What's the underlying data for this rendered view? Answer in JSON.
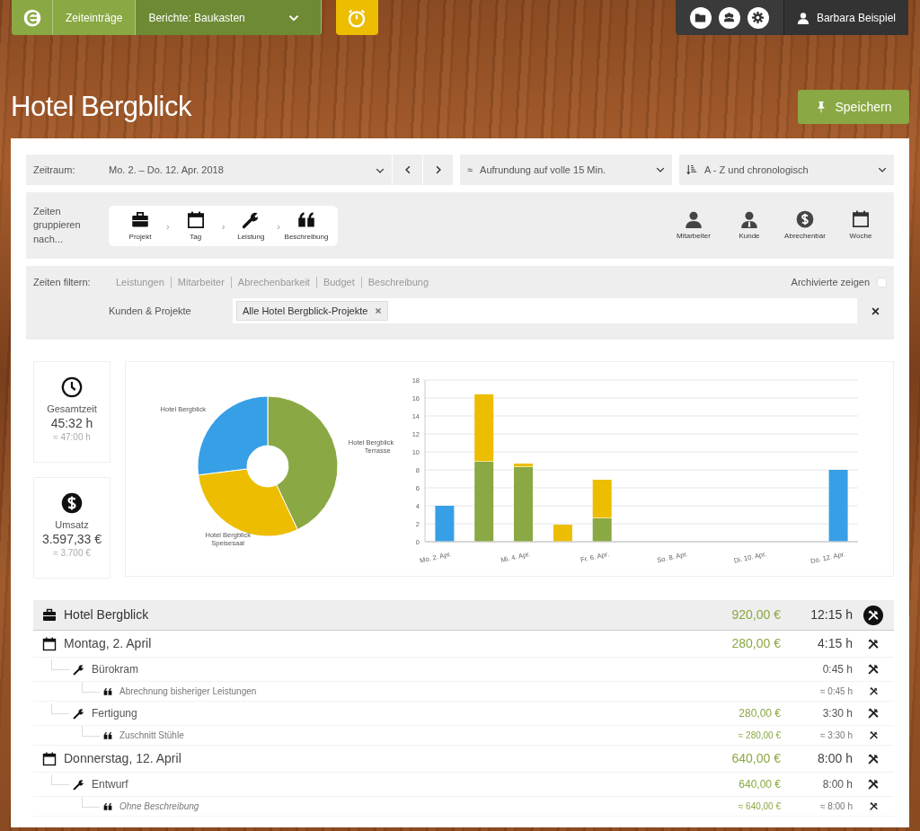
{
  "nav": {
    "tabs": [
      {
        "label": "Zeiteinträge",
        "selected": false
      },
      {
        "label": "Berichte: Baukasten",
        "selected": true
      }
    ],
    "user": "Barbara Beispiel"
  },
  "page_title": "Hotel Bergblick",
  "save_button": "Speichern",
  "period": {
    "label": "Zeitraum:",
    "value": "Mo. 2. – Do. 12. Apr. 2018"
  },
  "rounding": {
    "symbol": "≈",
    "value": "Aufrundung auf volle 15 Min."
  },
  "sorting": {
    "value": "A - Z und chronologisch"
  },
  "grouping": {
    "label": "Zeiten gruppieren nach...",
    "separator": "›",
    "active": [
      {
        "kind": "project",
        "label": "Projekt"
      },
      {
        "kind": "day",
        "label": "Tag"
      },
      {
        "kind": "service",
        "label": "Leistung"
      },
      {
        "kind": "description",
        "label": "Beschreibung"
      }
    ],
    "available": [
      {
        "kind": "person",
        "label": "Mitarbeiter"
      },
      {
        "kind": "customer",
        "label": "Kunde"
      },
      {
        "kind": "billable",
        "label": "Abrechenbar"
      },
      {
        "kind": "week",
        "label": "Woche"
      }
    ]
  },
  "filter": {
    "label": "Zeiten filtern:",
    "links": [
      "Leistungen",
      "Mitarbeiter",
      "Abrechenbarkeit",
      "Budget",
      "Beschreibung"
    ],
    "archived": {
      "label": "Archivierte zeigen",
      "checked": false
    },
    "customers_label": "Kunden & Projekte",
    "tags": [
      "Alle Hotel Bergblick-Projekte"
    ]
  },
  "stats": [
    {
      "kind": "time",
      "title": "Gesamtzeit",
      "value": "45:32 h",
      "estimate": "≈ 47:00 h"
    },
    {
      "kind": "money",
      "title": "Umsatz",
      "value": "3.597,33 €",
      "estimate": "≈ 3.700 €"
    }
  ],
  "pie": {
    "chart_data": {
      "type": "donut",
      "categories": [
        "Hotel Bergblick Terrasse",
        "Hotel Bergblick Speisesaal",
        "Hotel Bergblick"
      ],
      "values": [
        43,
        30,
        27
      ],
      "colors": [
        "#8aa843",
        "#ecbd00",
        "#379fe6"
      ]
    }
  },
  "bars": {
    "chart_data": {
      "type": "bar",
      "stacked": true,
      "grid": true,
      "categories": [
        "Mo. 2. Apr.",
        null,
        "Mi. 4. Apr.",
        null,
        "Fr. 6. Apr.",
        null,
        "So. 8. Apr.",
        null,
        "Di. 10. Apr.",
        null,
        "Do. 12. Apr."
      ],
      "ylim": [
        0,
        18
      ],
      "yticks": [
        0,
        2,
        4,
        6,
        8,
        10,
        12,
        14,
        16,
        18
      ],
      "series": [
        {
          "color": "#379fe6",
          "values": [
            4,
            0,
            0,
            0,
            0,
            0,
            0,
            0,
            0,
            0,
            8
          ]
        },
        {
          "color": "#8aa843",
          "values": [
            0,
            8.9,
            8.3,
            0,
            2.6,
            0,
            0,
            0,
            0,
            0,
            0
          ]
        },
        {
          "color": "#ecbd00",
          "values": [
            0,
            7.5,
            0.4,
            1.9,
            4.3,
            0,
            0,
            0,
            0,
            0,
            0
          ]
        }
      ]
    }
  },
  "report": [
    {
      "kind": "project",
      "label": "Hotel Bergblick",
      "amount": "920,00 €",
      "time": "12:15 h",
      "children": [
        {
          "kind": "day",
          "label": "Montag, 2. April",
          "amount": "280,00 €",
          "time": "4:15 h",
          "children": [
            {
              "kind": "service",
              "label": "Bürokram",
              "time": "0:45 h",
              "children": [
                {
                  "kind": "description",
                  "label": "Abrechnung bisheriger Leistungen",
                  "italic": false,
                  "time": "≈ 0:45 h"
                }
              ]
            },
            {
              "kind": "service",
              "label": "Fertigung",
              "amount": "280,00 €",
              "time": "3:30 h",
              "children": [
                {
                  "kind": "description",
                  "label": "Zuschnitt Stühle",
                  "italic": false,
                  "amount": "≈ 280,00 €",
                  "time": "≈ 3:30 h"
                }
              ]
            }
          ]
        },
        {
          "kind": "day",
          "label": "Donnerstag, 12. April",
          "amount": "640,00 €",
          "time": "8:00 h",
          "children": [
            {
              "kind": "service",
              "label": "Entwurf",
              "amount": "640,00 €",
              "time": "8:00 h",
              "children": [
                {
                  "kind": "description",
                  "label": "Ohne Beschreibung",
                  "italic": true,
                  "amount": "≈ 640,00 €",
                  "time": "≈ 8:00 h"
                }
              ]
            }
          ]
        }
      ]
    }
  ]
}
